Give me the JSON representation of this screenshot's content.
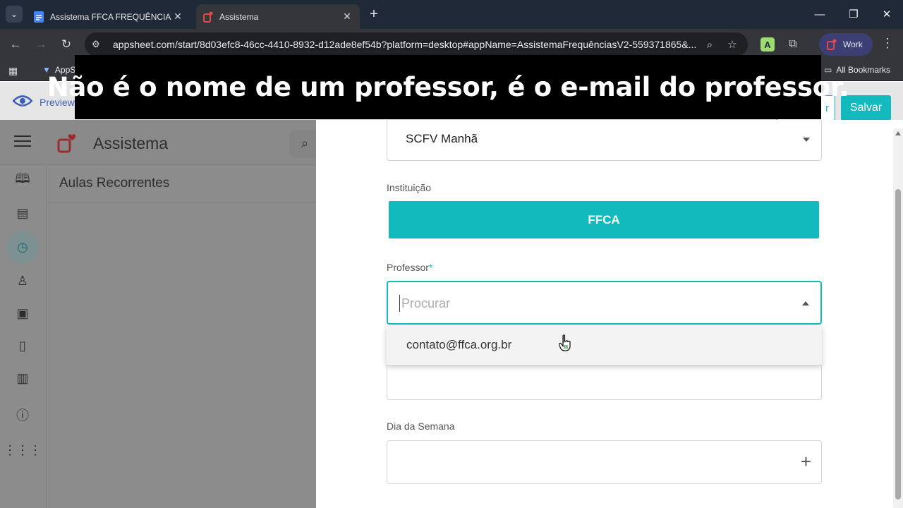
{
  "browser": {
    "tabs": [
      {
        "title": "Assistema FFCA FREQUÊNCIA - ",
        "icon": "google-docs-icon",
        "active": false
      },
      {
        "title": "Assistema",
        "icon": "assistema-icon",
        "active": true
      }
    ],
    "url": "appsheet.com/start/8d03efc8-46cc-4410-8932-d12ade8ef54b?platform=desktop#appName=AssistemaFrequênciasV2-559371865&...",
    "profile_label": "Work",
    "bookmarks": {
      "first_label": "AppS",
      "all_bookmarks_label": "All Bookmarks"
    }
  },
  "editor": {
    "preview_label": "Preview",
    "cancel_label": "r",
    "save_label": "Salvar"
  },
  "app": {
    "title": "Assistema",
    "view_title": "Aulas Recorrentes",
    "rail_icons": [
      "book-icon",
      "scroll-icon",
      "clock-icon",
      "teacher-icon",
      "book-plus-icon",
      "invoice-icon",
      "archive-icon",
      "info-icon",
      "grid-icon"
    ]
  },
  "form": {
    "top_field_value": "SCFV Manhã",
    "instituicao_label": "Instituição",
    "instituicao_value": "FFCA",
    "professor_label": "Professor",
    "required_mark": "*",
    "professor_placeholder": "Procurar",
    "dropdown_option": "contato@ffca.org.br",
    "dia_label": "Dia da Semana",
    "plus_symbol": "+"
  },
  "caption": {
    "text": "Não é o nome de um professor, é o e-mail do professor."
  },
  "colors": {
    "accent": "#12b9bd",
    "caption_bg": "#000000",
    "chrome_dark": "#1f2937"
  }
}
